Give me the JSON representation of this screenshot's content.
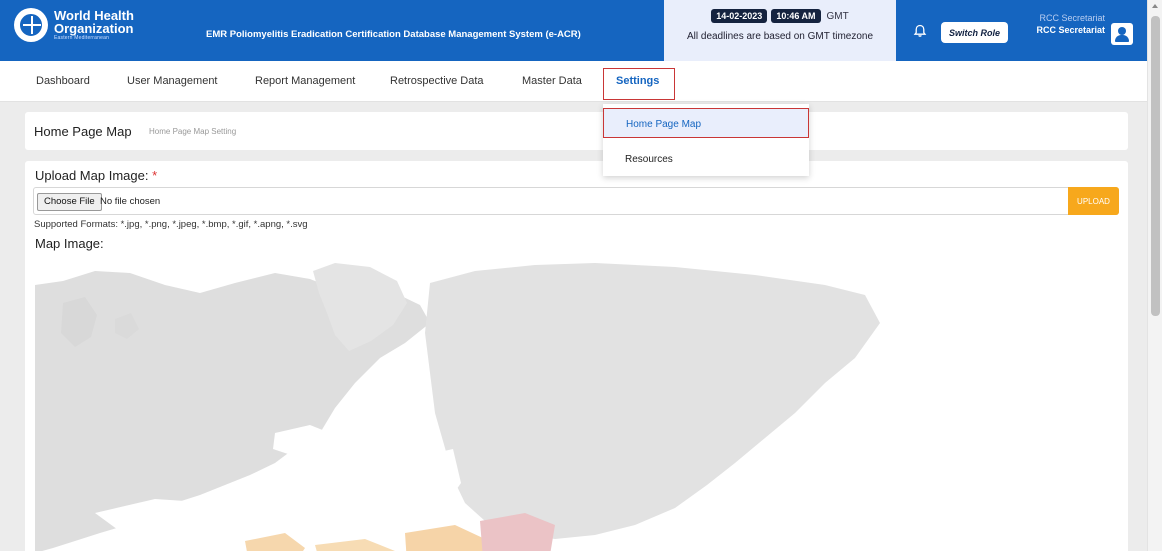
{
  "header": {
    "org_line1": "World Health",
    "org_line2": "Organization",
    "org_line3": "Eastern Mediterranean",
    "app_title": "EMR Poliomyelitis Eradication Certification Database Management System (e-ACR)",
    "date": "14-02-2023",
    "time": "10:46 AM",
    "timezone": "GMT",
    "deadline_note": "All deadlines are based on GMT timezone",
    "switch_role_label": "Switch Role",
    "role_faded": "RCC Secretariat",
    "role_current": "RCC Secretariat",
    "brand_color": "#1565c0"
  },
  "nav": {
    "items": [
      {
        "label": "Dashboard"
      },
      {
        "label": "User Management"
      },
      {
        "label": "Report Management"
      },
      {
        "label": "Retrospective Data"
      },
      {
        "label": "Master Data"
      },
      {
        "label": "Settings",
        "active": true
      }
    ]
  },
  "dropdown": {
    "items": [
      {
        "label": "Home Page Map",
        "highlighted": true
      },
      {
        "label": "Resources"
      }
    ]
  },
  "breadcrumb": {
    "title": "Home Page Map",
    "subtitle": "Home Page Map Setting"
  },
  "upload": {
    "label": "Upload Map Image:",
    "required_mark": "*",
    "choose_file_label": "Choose File",
    "file_status": "No file chosen",
    "upload_button": "UPLOAD",
    "upload_color": "#f7a81c",
    "formats": "Supported Formats: *.jpg, *.png, *.jpeg, *.bmp, *.gif, *.apng, *.svg"
  },
  "map": {
    "label": "Map Image:"
  }
}
